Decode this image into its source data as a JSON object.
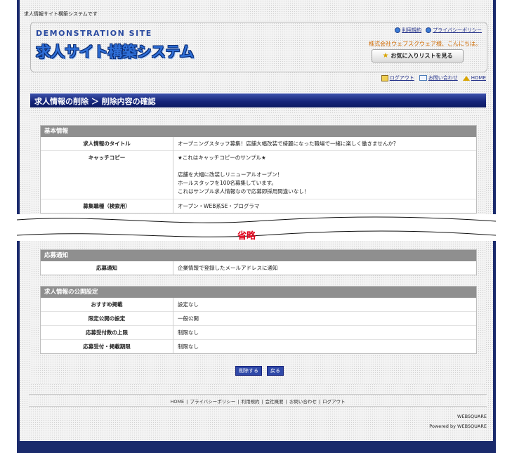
{
  "top_note": "求人情報サイト構築システムです",
  "header": {
    "demo_label": "DEMONSTRATION SITE",
    "logo_text": "求人サイト構築システム",
    "links": [
      "利用規約",
      "プライバシーポリシー"
    ],
    "greeting": "株式会社ウェブスクウェア様、こんにちは。",
    "favorites_button": "お気に入りリストを見る"
  },
  "subnav": [
    "ログアウト",
    "お問い合わせ",
    "HOME"
  ],
  "page_title": "求人情報の削除 ＞ 削除内容の確認",
  "sections": {
    "basic": {
      "heading": "基本情報",
      "rows": [
        {
          "label": "求人情報のタイトル",
          "value": "オープニングスタッフ募集！店舗大幅改装で綺麗になった職場で一緒に楽しく働きませんか？"
        },
        {
          "label": "キャッチコピー",
          "value": "★これはキャッチコピーのサンプル★\n\n店舗を大幅に改装しリニューアルオープン！\nホールスタッフを100名募集しています。\nこれはサンプル求人情報なので応募即採用間違いなし！"
        },
        {
          "label": "募集職種（検索用）",
          "value": "オープン・WEB系SE・プログラマ"
        }
      ]
    },
    "apply": {
      "heading": "応募通知",
      "rows": [
        {
          "label": "応募通知",
          "value": "企業情報で登録したメールアドレスに通知"
        }
      ]
    },
    "publish": {
      "heading": "求人情報の公開設定",
      "rows": [
        {
          "label": "おすすめ掲載",
          "value": "設定なし"
        },
        {
          "label": "限定公開の設定",
          "value": "一般公開"
        },
        {
          "label": "応募受付数の上限",
          "value": "制限なし"
        },
        {
          "label": "応募受付・掲載期限",
          "value": "制限なし"
        }
      ]
    }
  },
  "omitted_label": "省略",
  "buttons": {
    "delete": "削除する",
    "back": "戻る"
  },
  "footer": {
    "links": [
      "HOME",
      "プライバシーポリシー",
      "利用規約",
      "会社概要",
      "お問い合わせ",
      "ログアウト"
    ],
    "company": "WEBSQUARE",
    "powered": "Powered by WEBSQUARE"
  }
}
